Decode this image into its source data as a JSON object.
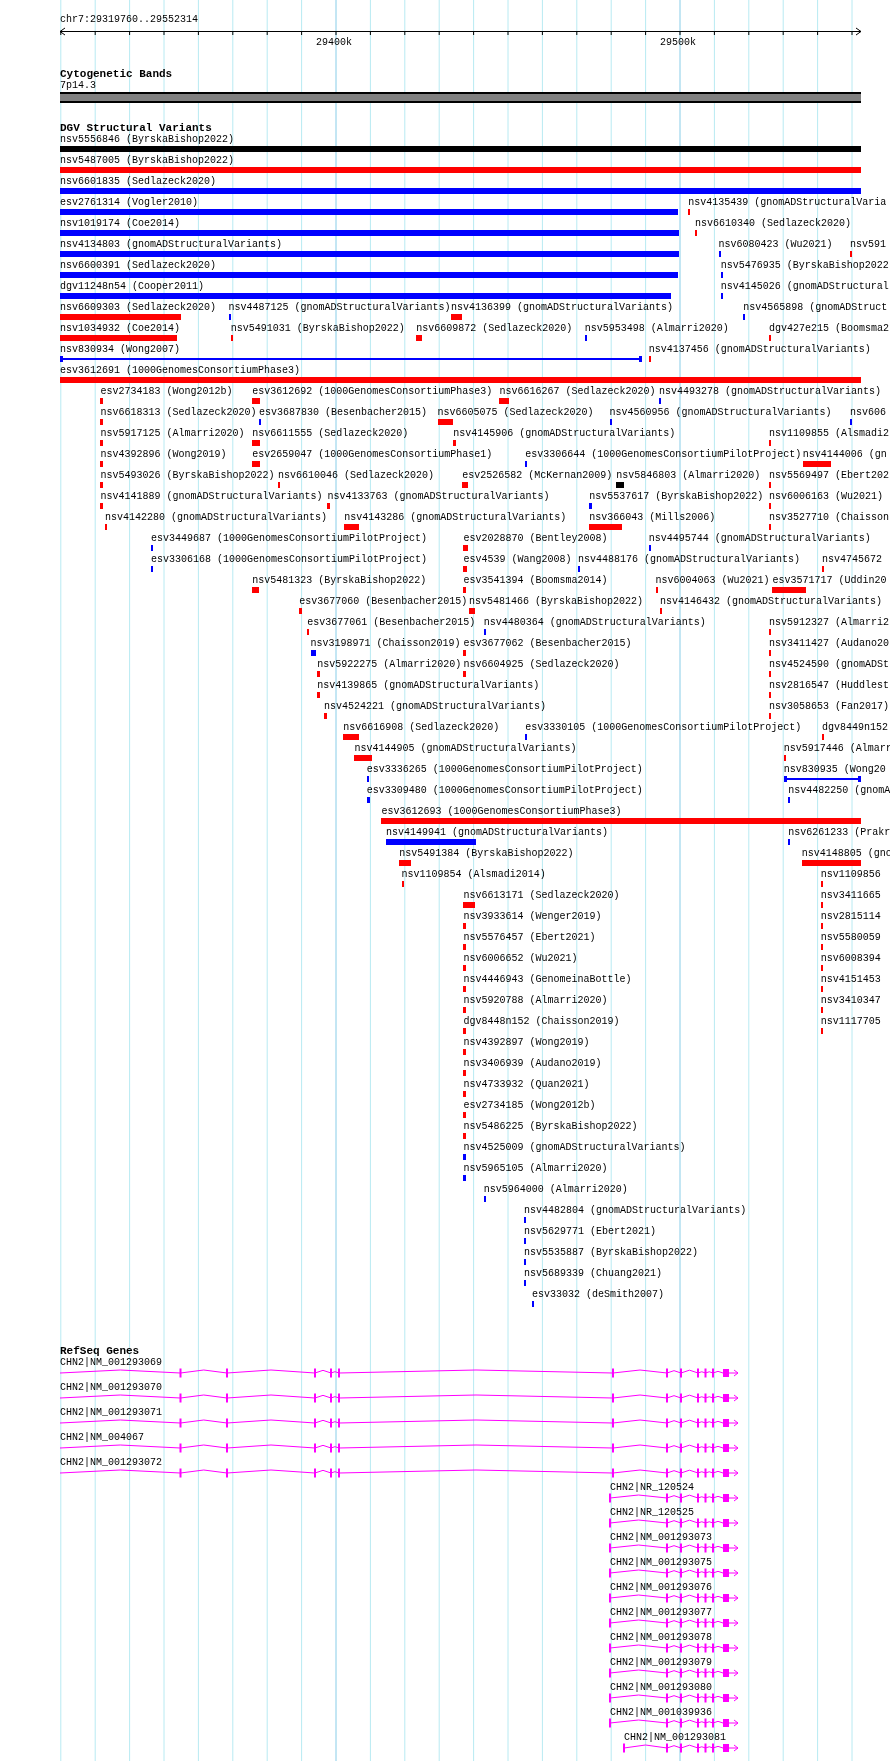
{
  "ruler": {
    "location": "chr7:29319760..29552314",
    "ticks": [
      "29400k",
      "29500k"
    ]
  },
  "cytogenetic_bands": {
    "title": "Cytogenetic Bands",
    "band": "7p14.3"
  },
  "dgv": {
    "title": "DGV Structural Variants",
    "rows": [
      {
        "features": [
          {
            "label": "nsv5556846 (ByrskaBishop2022)",
            "color": "#000000",
            "kind": "bar"
          }
        ]
      },
      {
        "features": [
          {
            "label": "nsv5487005 (ByrskaBishop2022)",
            "color": "#ff0000",
            "kind": "bar"
          }
        ]
      },
      {
        "features": [
          {
            "label": "nsv6601835 (Sedlazeck2020)",
            "color": "#0000ff",
            "kind": "bar"
          }
        ]
      },
      {
        "features": [
          {
            "label": "esv2761314 (Vogler2010)",
            "color": "#0000ff",
            "kind": "bar"
          },
          {
            "label": "nsv4135439 (gnomADStructuralVaria",
            "color": "#ff0000",
            "kind": "bar"
          }
        ]
      },
      {
        "features": [
          {
            "label": "nsv1019174 (Coe2014)",
            "color": "#0000ff",
            "kind": "bar"
          },
          {
            "label": "nsv6610340 (Sedlazeck2020)",
            "color": "#ff0000",
            "kind": "bar"
          }
        ]
      },
      {
        "features": [
          {
            "label": "nsv4134803 (gnomADStructuralVariants)",
            "color": "#0000ff",
            "kind": "bar"
          },
          {
            "label": "nsv6080423 (Wu2021)",
            "color": "#0000ff",
            "kind": "bar"
          },
          {
            "label": "nsv591",
            "color": "#ff0000",
            "kind": "bar"
          }
        ]
      },
      {
        "features": [
          {
            "label": "nsv6600391 (Sedlazeck2020)",
            "color": "#0000ff",
            "kind": "bar"
          },
          {
            "label": "nsv5476935 (ByrskaBishop2022",
            "color": "#0000ff",
            "kind": "bar"
          }
        ]
      },
      {
        "features": [
          {
            "label": "dgv11248n54 (Cooper2011)",
            "color": "#0000ff",
            "kind": "bar"
          },
          {
            "label": "nsv4145026 (gnomADStructural",
            "color": "#0000ff",
            "kind": "bar"
          }
        ]
      },
      {
        "features": [
          {
            "label": "nsv6609303 (Sedlazeck2020)",
            "color": "#ff0000",
            "kind": "bar"
          },
          {
            "label": "nsv4487125 (gnomADStructuralVariants)",
            "color": "#0000ff",
            "kind": "bar"
          },
          {
            "label": "nsv4136399 (gnomADStructuralVariants)",
            "color": "#ff0000",
            "kind": "bar"
          },
          {
            "label": "nsv4565898 (gnomADStruct",
            "color": "#0000ff",
            "kind": "bar"
          }
        ]
      },
      {
        "features": [
          {
            "label": "nsv1034932 (Coe2014)",
            "color": "#ff0000",
            "kind": "bar"
          },
          {
            "label": "nsv5491031 (ByrskaBishop2022)",
            "color": "#ff0000",
            "kind": "bar"
          },
          {
            "label": "nsv6609872 (Sedlazeck2020)",
            "color": "#ff0000",
            "kind": "bar"
          },
          {
            "label": "nsv5953498 (Almarri2020)",
            "color": "#0000ff",
            "kind": "bar"
          },
          {
            "label": "dgv427e215 (Boomsma2",
            "color": "#ff0000",
            "kind": "bar"
          }
        ]
      },
      {
        "features": [
          {
            "label": "nsv830934 (Wong2007)",
            "color": "#0000ff",
            "kind": "line"
          },
          {
            "label": "nsv4137456 (gnomADStructuralVariants)",
            "color": "#ff0000",
            "kind": "bar"
          }
        ]
      },
      {
        "features": [
          {
            "label": "esv3612691 (1000GenomesConsortiumPhase3)",
            "color": "#ff0000",
            "kind": "bar"
          }
        ]
      },
      {
        "features": [
          {
            "label": "esv2734183 (Wong2012b)",
            "color": "#ff0000",
            "kind": "bar"
          },
          {
            "label": "esv3612692 (1000GenomesConsortiumPhase3)",
            "color": "#ff0000",
            "kind": "bar"
          },
          {
            "label": "nsv6616267 (Sedlazeck2020)",
            "color": "#ff0000",
            "kind": "bar"
          },
          {
            "label": "nsv4493278 (gnomADStructuralVariants)",
            "color": "#0000ff",
            "kind": "bar"
          }
        ]
      },
      {
        "features": [
          {
            "label": "nsv6618313 (Sedlazeck2020)",
            "color": "#ff0000",
            "kind": "bar"
          },
          {
            "label": "esv3687830 (Besenbacher2015)",
            "color": "#0000ff",
            "kind": "bar"
          },
          {
            "label": "nsv6605075 (Sedlazeck2020)",
            "color": "#ff0000",
            "kind": "bar"
          },
          {
            "label": "nsv4560956 (gnomADStructuralVariants)",
            "color": "#0000ff",
            "kind": "bar"
          },
          {
            "label": "nsv606",
            "color": "#0000ff",
            "kind": "bar"
          }
        ]
      },
      {
        "features": [
          {
            "label": "nsv5917125 (Almarri2020)",
            "color": "#ff0000",
            "kind": "bar"
          },
          {
            "label": "nsv6611555 (Sedlazeck2020)",
            "color": "#ff0000",
            "kind": "bar"
          },
          {
            "label": "nsv4145906 (gnomADStructuralVariants)",
            "color": "#ff0000",
            "kind": "bar"
          },
          {
            "label": "nsv1109855 (Alsmadi2",
            "color": "#ff0000",
            "kind": "bar"
          }
        ]
      },
      {
        "features": [
          {
            "label": "nsv4392896 (Wong2019)",
            "color": "#ff0000",
            "kind": "bar"
          },
          {
            "label": "esv2659047 (1000GenomesConsortiumPhase1)",
            "color": "#ff0000",
            "kind": "bar"
          },
          {
            "label": "esv3306644 (1000GenomesConsortiumPilotProject)",
            "color": "#0000ff",
            "kind": "bar"
          },
          {
            "label": "nsv4144006 (gn",
            "color": "#ff0000",
            "kind": "bar"
          }
        ]
      },
      {
        "features": [
          {
            "label": "nsv5493026 (ByrskaBishop2022)",
            "color": "#ff0000",
            "kind": "bar"
          },
          {
            "label": "nsv6610046 (Sedlazeck2020)",
            "color": "#ff0000",
            "kind": "bar"
          },
          {
            "label": "esv2526582 (McKernan2009)",
            "color": "#ff0000",
            "kind": "bar"
          },
          {
            "label": "nsv5846803 (Almarri2020)",
            "color": "#000000",
            "kind": "bar"
          },
          {
            "label": "nsv5569497 (Ebert202",
            "color": "#ff0000",
            "kind": "bar"
          }
        ]
      },
      {
        "features": [
          {
            "label": "nsv4141889 (gnomADStructuralVariants)",
            "color": "#ff0000",
            "kind": "bar"
          },
          {
            "label": "nsv4133763 (gnomADStructuralVariants)",
            "color": "#ff0000",
            "kind": "bar"
          },
          {
            "label": "nsv5537617 (ByrskaBishop2022)",
            "color": "#0000ff",
            "kind": "bar"
          },
          {
            "label": "nsv6006163 (Wu2021)",
            "color": "#ff0000",
            "kind": "bar"
          }
        ]
      },
      {
        "features": [
          {
            "label": "nsv4142280 (gnomADStructuralVariants)",
            "color": "#ff0000",
            "kind": "bar"
          },
          {
            "label": "nsv4143286 (gnomADStructuralVariants)",
            "color": "#ff0000",
            "kind": "bar"
          },
          {
            "label": "nsv366043 (Mills2006)",
            "color": "#ff0000",
            "kind": "bar"
          },
          {
            "label": "nsv3527710 (Chaisson",
            "color": "#ff0000",
            "kind": "bar"
          }
        ]
      },
      {
        "features": [
          {
            "label": "esv3449687 (1000GenomesConsortiumPilotProject)",
            "color": "#0000ff",
            "kind": "bar"
          },
          {
            "label": "esv2028870 (Bentley2008)",
            "color": "#ff0000",
            "kind": "bar"
          },
          {
            "label": "nsv4495744 (gnomADStructuralVariants)",
            "color": "#0000ff",
            "kind": "bar"
          }
        ]
      },
      {
        "features": [
          {
            "label": "esv3306168 (1000GenomesConsortiumPilotProject)",
            "color": "#0000ff",
            "kind": "bar"
          },
          {
            "label": "esv4539 (Wang2008)",
            "color": "#ff0000",
            "kind": "bar"
          },
          {
            "label": "nsv4488176 (gnomADStructuralVariants)",
            "color": "#0000ff",
            "kind": "bar"
          },
          {
            "label": "nsv4745672",
            "color": "#ff0000",
            "kind": "bar"
          }
        ]
      },
      {
        "features": [
          {
            "label": "nsv5481323 (ByrskaBishop2022)",
            "color": "#ff0000",
            "kind": "bar"
          },
          {
            "label": "esv3541394 (Boomsma2014)",
            "color": "#ff0000",
            "kind": "bar"
          },
          {
            "label": "nsv6004063 (Wu2021)",
            "color": "#ff0000",
            "kind": "bar"
          },
          {
            "label": "esv3571717 (Uddin20",
            "color": "#ff0000",
            "kind": "bar"
          }
        ]
      },
      {
        "features": [
          {
            "label": "esv3677060 (Besenbacher2015)",
            "color": "#ff0000",
            "kind": "bar"
          },
          {
            "label": "nsv5481466 (ByrskaBishop2022)",
            "color": "#ff0000",
            "kind": "bar"
          },
          {
            "label": "nsv4146432 (gnomADStructuralVariants)",
            "color": "#ff0000",
            "kind": "bar"
          }
        ]
      },
      {
        "features": [
          {
            "label": "esv3677061 (Besenbacher2015)",
            "color": "#ff0000",
            "kind": "bar"
          },
          {
            "label": "nsv4480364 (gnomADStructuralVariants)",
            "color": "#0000ff",
            "kind": "bar"
          },
          {
            "label": "nsv5912327 (Almarri2",
            "color": "#ff0000",
            "kind": "bar"
          }
        ]
      },
      {
        "features": [
          {
            "label": "nsv3198971 (Chaisson2019)",
            "color": "#0000ff",
            "kind": "bar"
          },
          {
            "label": "esv3677062 (Besenbacher2015)",
            "color": "#ff0000",
            "kind": "bar"
          },
          {
            "label": "nsv3411427 (Audano20",
            "color": "#ff0000",
            "kind": "bar"
          }
        ]
      },
      {
        "features": [
          {
            "label": "nsv5922275 (Almarri2020)",
            "color": "#ff0000",
            "kind": "bar"
          },
          {
            "label": "nsv6604925 (Sedlazeck2020)",
            "color": "#ff0000",
            "kind": "bar"
          },
          {
            "label": "nsv4524590 (gnomADSt",
            "color": "#ff0000",
            "kind": "bar"
          }
        ]
      },
      {
        "features": [
          {
            "label": "nsv4139865 (gnomADStructuralVariants)",
            "color": "#ff0000",
            "kind": "bar"
          },
          {
            "label": "nsv2816547 (Huddlest",
            "color": "#ff0000",
            "kind": "bar"
          }
        ]
      },
      {
        "features": [
          {
            "label": "nsv4524221 (gnomADStructuralVariants)",
            "color": "#ff0000",
            "kind": "bar"
          },
          {
            "label": "nsv3058653 (Fan2017)",
            "color": "#ff0000",
            "kind": "bar"
          }
        ]
      },
      {
        "features": [
          {
            "label": "nsv6616908 (Sedlazeck2020)",
            "color": "#ff0000",
            "kind": "bar"
          },
          {
            "label": "esv3330105 (1000GenomesConsortiumPilotProject)",
            "color": "#0000ff",
            "kind": "bar"
          },
          {
            "label": "dgv8449n152",
            "color": "#ff0000",
            "kind": "bar"
          }
        ]
      },
      {
        "features": [
          {
            "label": "nsv4144905 (gnomADStructuralVariants)",
            "color": "#ff0000",
            "kind": "bar"
          },
          {
            "label": "nsv5917446 (Almarr",
            "color": "#ff0000",
            "kind": "bar"
          }
        ]
      },
      {
        "features": [
          {
            "label": "esv3336265 (1000GenomesConsortiumPilotProject)",
            "color": "#0000ff",
            "kind": "bar"
          },
          {
            "label": "nsv830935 (Wong20",
            "color": "#0000ff",
            "kind": "line"
          }
        ]
      },
      {
        "features": [
          {
            "label": "esv3309480 (1000GenomesConsortiumPilotProject)",
            "color": "#0000ff",
            "kind": "bar"
          },
          {
            "label": "nsv4482250 (gnomA",
            "color": "#0000ff",
            "kind": "bar"
          }
        ]
      },
      {
        "features": [
          {
            "label": "esv3612693 (1000GenomesConsortiumPhase3)",
            "color": "#ff0000",
            "kind": "bar"
          }
        ]
      },
      {
        "features": [
          {
            "label": "nsv4149941 (gnomADStructuralVariants)",
            "color": "#0000ff",
            "kind": "bar"
          },
          {
            "label": "nsv6261233 (Prakr",
            "color": "#0000ff",
            "kind": "bar"
          }
        ]
      },
      {
        "features": [
          {
            "label": "nsv5491384 (ByrskaBishop2022)",
            "color": "#ff0000",
            "kind": "bar"
          },
          {
            "label": "nsv4148805 (gno",
            "color": "#ff0000",
            "kind": "bar"
          }
        ]
      },
      {
        "features": [
          {
            "label": "nsv1109854 (Alsmadi2014)",
            "color": "#ff0000",
            "kind": "bar"
          },
          {
            "label": "nsv1109856",
            "color": "#ff0000",
            "kind": "bar"
          }
        ]
      },
      {
        "features": [
          {
            "label": "nsv6613171 (Sedlazeck2020)",
            "color": "#ff0000",
            "kind": "bar"
          },
          {
            "label": "nsv3411665",
            "color": "#ff0000",
            "kind": "bar"
          }
        ]
      },
      {
        "features": [
          {
            "label": "nsv3933614 (Wenger2019)",
            "color": "#ff0000",
            "kind": "bar"
          },
          {
            "label": "nsv2815114",
            "color": "#ff0000",
            "kind": "bar"
          }
        ]
      },
      {
        "features": [
          {
            "label": "nsv5576457 (Ebert2021)",
            "color": "#ff0000",
            "kind": "bar"
          },
          {
            "label": "nsv5580059",
            "color": "#ff0000",
            "kind": "bar"
          }
        ]
      },
      {
        "features": [
          {
            "label": "nsv6006652 (Wu2021)",
            "color": "#ff0000",
            "kind": "bar"
          },
          {
            "label": "nsv6008394",
            "color": "#ff0000",
            "kind": "bar"
          }
        ]
      },
      {
        "features": [
          {
            "label": "nsv4446943 (GenomeinaBottle)",
            "color": "#ff0000",
            "kind": "bar"
          },
          {
            "label": "nsv4151453",
            "color": "#ff0000",
            "kind": "bar"
          }
        ]
      },
      {
        "features": [
          {
            "label": "nsv5920788 (Almarri2020)",
            "color": "#ff0000",
            "kind": "bar"
          },
          {
            "label": "nsv3410347",
            "color": "#ff0000",
            "kind": "bar"
          }
        ]
      },
      {
        "features": [
          {
            "label": "dgv8448n152 (Chaisson2019)",
            "color": "#ff0000",
            "kind": "bar"
          },
          {
            "label": "nsv1117705",
            "color": "#ff0000",
            "kind": "bar"
          }
        ]
      },
      {
        "features": [
          {
            "label": "nsv4392897 (Wong2019)",
            "color": "#ff0000",
            "kind": "bar"
          }
        ]
      },
      {
        "features": [
          {
            "label": "nsv3406939 (Audano2019)",
            "color": "#ff0000",
            "kind": "bar"
          }
        ]
      },
      {
        "features": [
          {
            "label": "nsv4733932 (Quan2021)",
            "color": "#ff0000",
            "kind": "bar"
          }
        ]
      },
      {
        "features": [
          {
            "label": "esv2734185 (Wong2012b)",
            "color": "#ff0000",
            "kind": "bar"
          }
        ]
      },
      {
        "features": [
          {
            "label": "nsv5486225 (ByrskaBishop2022)",
            "color": "#ff0000",
            "kind": "bar"
          }
        ]
      },
      {
        "features": [
          {
            "label": "nsv4525009 (gnomADStructuralVariants)",
            "color": "#0000ff",
            "kind": "bar"
          }
        ]
      },
      {
        "features": [
          {
            "label": "nsv5965105 (Almarri2020)",
            "color": "#0000ff",
            "kind": "bar"
          }
        ]
      },
      {
        "features": [
          {
            "label": "nsv5964000 (Almarri2020)",
            "color": "#0000ff",
            "kind": "bar"
          }
        ]
      },
      {
        "features": [
          {
            "label": "nsv4482804 (gnomADStructuralVariants)",
            "color": "#0000ff",
            "kind": "bar"
          }
        ]
      },
      {
        "features": [
          {
            "label": "nsv5629771 (Ebert2021)",
            "color": "#0000ff",
            "kind": "bar"
          }
        ]
      },
      {
        "features": [
          {
            "label": "nsv5535887 (ByrskaBishop2022)",
            "color": "#0000ff",
            "kind": "bar"
          }
        ]
      },
      {
        "features": [
          {
            "label": "nsv5689339 (Chuang2021)",
            "color": "#0000ff",
            "kind": "bar"
          }
        ]
      },
      {
        "features": [
          {
            "label": "esv33032 (deSmith2007)",
            "color": "#0000ff",
            "kind": "bar"
          }
        ]
      }
    ]
  },
  "refseq_genes": {
    "title": "RefSeq Genes",
    "transcripts": [
      {
        "label": "CHN2|NM_001293069"
      },
      {
        "label": "CHN2|NM_001293070"
      },
      {
        "label": "CHN2|NM_001293071"
      },
      {
        "label": "CHN2|NM_004067"
      },
      {
        "label": "CHN2|NM_001293072"
      },
      {
        "label": "CHN2|NR_120524"
      },
      {
        "label": "CHN2|NR_120525"
      },
      {
        "label": "CHN2|NM_001293073"
      },
      {
        "label": "CHN2|NM_001293075"
      },
      {
        "label": "CHN2|NM_001293076"
      },
      {
        "label": "CHN2|NM_001293077"
      },
      {
        "label": "CHN2|NM_001293078"
      },
      {
        "label": "CHN2|NM_001293079"
      },
      {
        "label": "CHN2|NM_001293080"
      },
      {
        "label": "CHN2|NM_001039936"
      },
      {
        "label": "CHN2|NM_001293081"
      }
    ]
  }
}
